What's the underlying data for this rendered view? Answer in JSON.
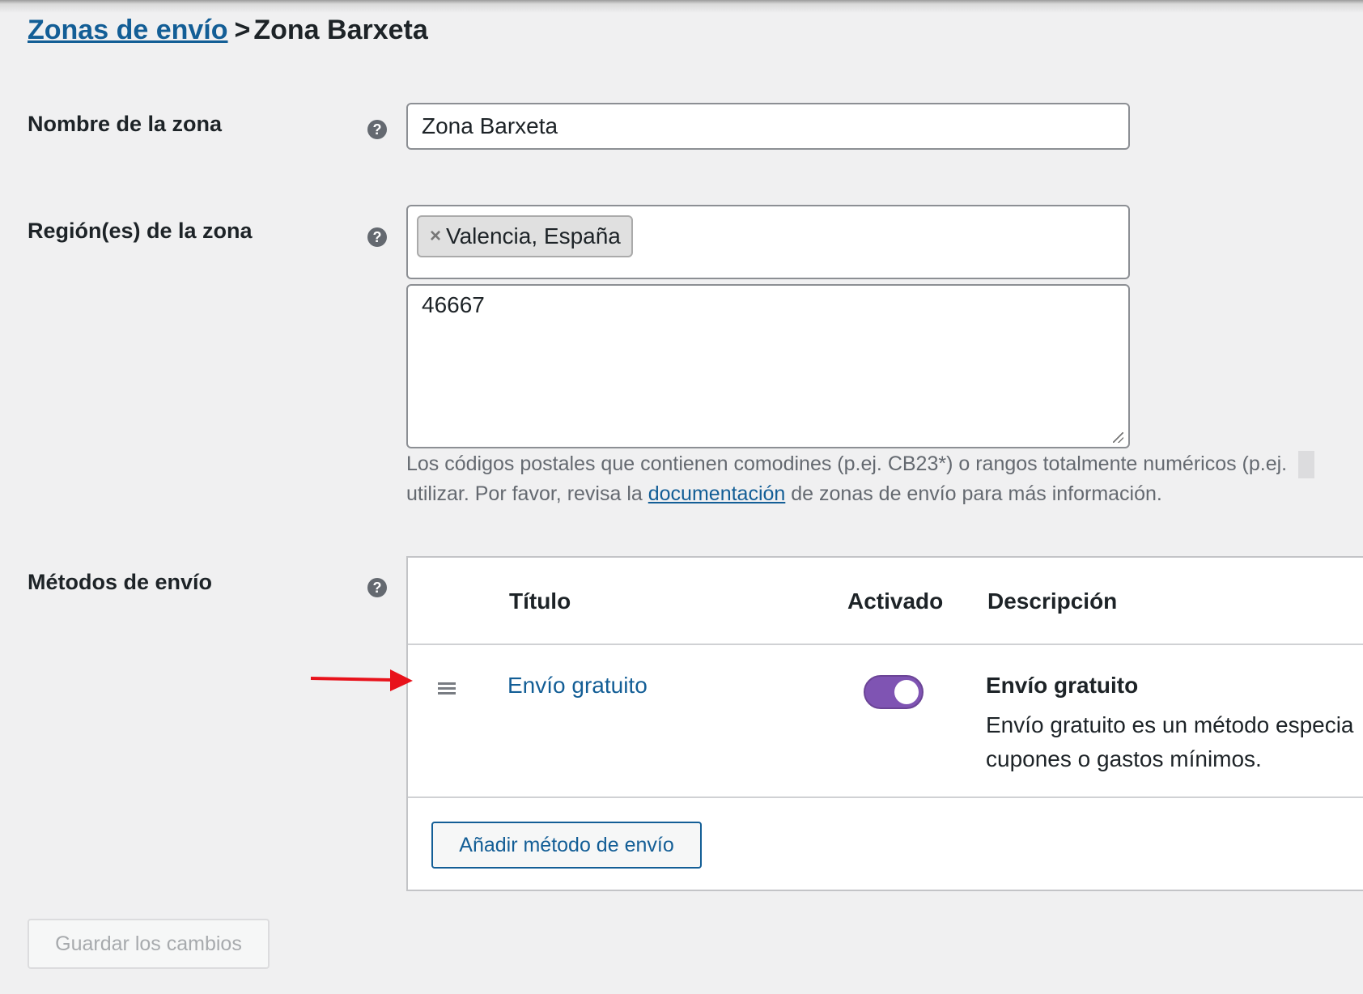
{
  "breadcrumb": {
    "parent": "Zonas de envío",
    "separator": ">",
    "current": "Zona Barxeta"
  },
  "zone_name": {
    "label": "Nombre de la zona",
    "value": "Zona Barxeta"
  },
  "zone_regions": {
    "label": "Región(es) de la zona",
    "selected_chip": "Valencia, España",
    "chip_remove": "×",
    "postcodes": "46667",
    "help_text_line1": "Los códigos postales que contienen comodines (p.ej. CB23*) o rangos totalmente numéricos (p.ej.",
    "help_text_line2_before": "utilizar. Por favor, revisa la",
    "help_text_link": "documentación",
    "help_text_line2_after": "de zonas de envío para más información."
  },
  "shipping_methods": {
    "label": "Métodos de envío",
    "columns": {
      "title": "Título",
      "enabled": "Activado",
      "description": "Descripción"
    },
    "rows": [
      {
        "title": "Envío gratuito",
        "enabled": true,
        "description_title": "Envío gratuito",
        "description_line1": "Envío gratuito es un método especia",
        "description_line2": "cupones o gastos mínimos."
      }
    ],
    "add_button": "Añadir método de envío"
  },
  "help_icon_glyph": "?",
  "save_button": "Guardar los cambios",
  "colors": {
    "link": "#135e96",
    "toggle_on": "#7f54b3",
    "annotation_arrow": "#e8121b",
    "background": "#f0f0f1"
  }
}
